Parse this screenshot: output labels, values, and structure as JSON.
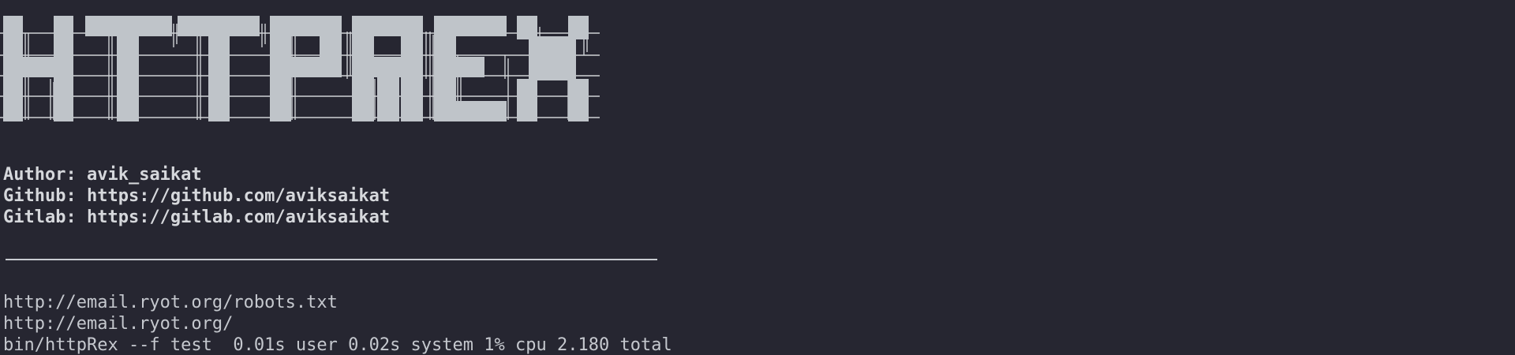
{
  "banner": {
    "text": "HTTPREX",
    "color": "#bfc4c9",
    "line_color": "#cfd2d6"
  },
  "info": {
    "author_label": "Author:",
    "author_value": "avik_saikat",
    "github_label": "Github:",
    "github_value": "https://github.com/aviksaikat",
    "gitlab_label": "Gitlab:",
    "gitlab_value": "https://gitlab.com/aviksaikat"
  },
  "output": {
    "lines": [
      "http://email.ryot.org/robots.txt",
      "http://email.ryot.org/",
      "bin/httpRex --f test  0.01s user 0.02s system 1% cpu 2.180 total"
    ]
  },
  "colors": {
    "background": "#262631",
    "foreground": "#c8cbd1"
  }
}
